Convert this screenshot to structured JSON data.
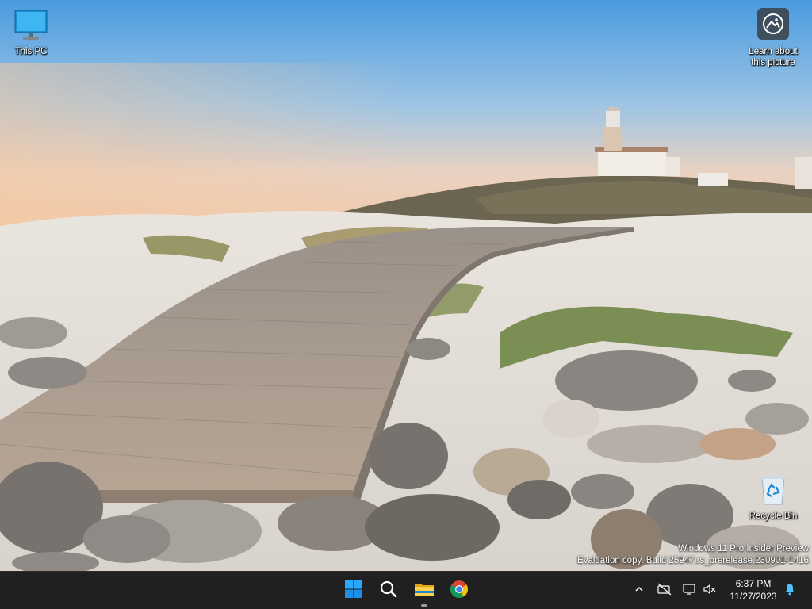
{
  "desktop": {
    "icons": [
      {
        "id": "this_pc",
        "label": "This PC",
        "icon": "monitor-icon"
      },
      {
        "id": "learn_picture",
        "label": "Learn about this picture",
        "icon": "camera-icon"
      },
      {
        "id": "recycle_bin",
        "label": "Recycle Bin",
        "icon": "recycle-bin-icon"
      }
    ],
    "watermark": {
      "line1": "Windows 11 Pro Insider Preview",
      "line2": "Evaluation copy. Build 25947.rs_prerelease.230901-1416"
    }
  },
  "taskbar": {
    "apps": [
      {
        "id": "start",
        "icon": "windows-start-icon"
      },
      {
        "id": "search",
        "icon": "search-icon"
      },
      {
        "id": "file_explorer",
        "icon": "folder-icon",
        "running": true
      },
      {
        "id": "chrome",
        "icon": "chrome-icon"
      }
    ],
    "tray": {
      "icons": [
        "chevron-up-icon",
        "network-disconnected-icon",
        "display-icon",
        "volume-muted-icon",
        "notification-bell-icon"
      ],
      "time": "6:37 PM",
      "date": "11/27/2023"
    }
  },
  "colors": {
    "taskbar_bg": "#202020",
    "accent": "#0078d4",
    "bell": "#4cc2ff"
  }
}
